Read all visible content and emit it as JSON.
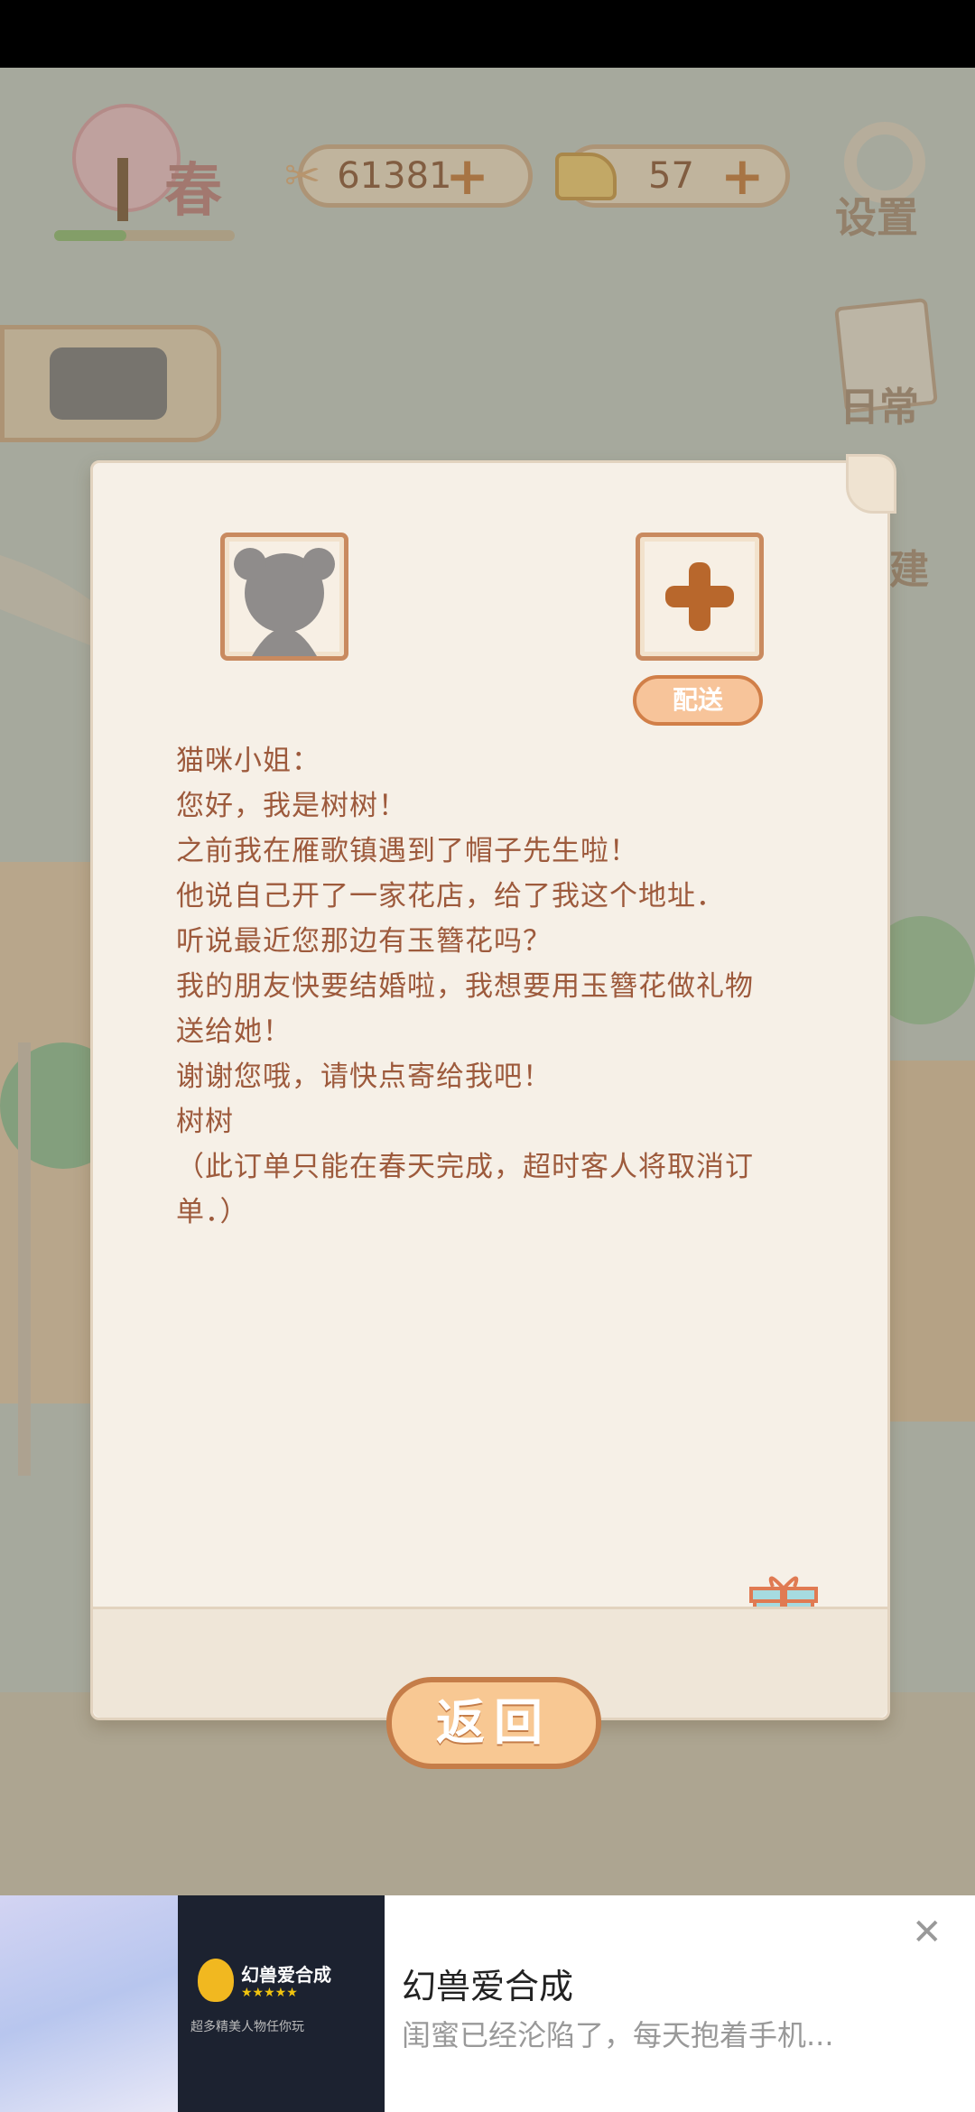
{
  "hud": {
    "season": "春",
    "fish_count": "61381",
    "cheese_count": "57",
    "settings_label": "设置",
    "daily_label": "日常",
    "build_label": "建"
  },
  "letter": {
    "deliver_label": "配送",
    "lines": [
      "猫咪小姐：",
      "您好，我是树树！",
      "之前我在雁歌镇遇到了帽子先生啦！",
      "他说自己开了一家花店，给了我这个地址．",
      "听说最近您那边有玉簪花吗？",
      "我的朋友快要结婚啦，我想要用玉簪花做礼物",
      "送给她！",
      "谢谢您哦，请快点寄给我吧！",
      "树树",
      "（此订单只能在春天完成，超时客人将取消订",
      "单．）"
    ],
    "back_label": "返回"
  },
  "ad": {
    "game_name": "幻兽爱合成",
    "tagline": "超多精美人物任你玩",
    "title": "幻兽爱合成",
    "description": "闺蜜已经沦陷了，每天抱着手机..."
  },
  "icons": {
    "plus": "plus-icon",
    "gift": "gift-icon",
    "close": "close-icon"
  },
  "colors": {
    "accent": "#d08a4c",
    "letter_text": "#9d5a3c"
  }
}
